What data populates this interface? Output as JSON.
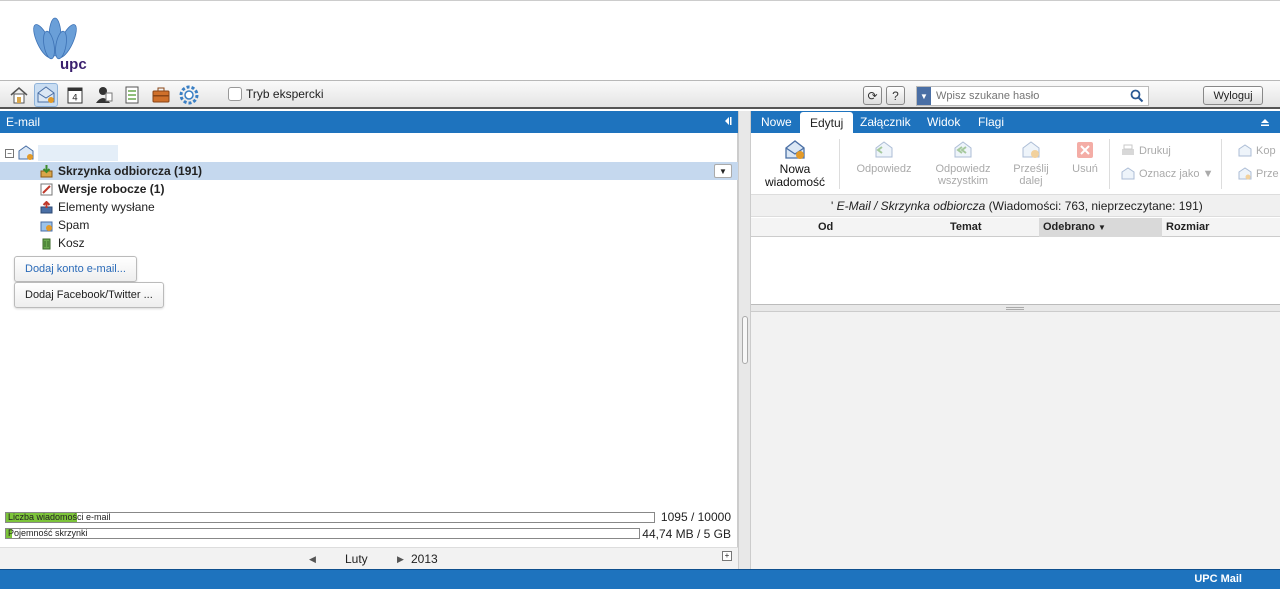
{
  "brand": {
    "logo_text": "upc"
  },
  "toolbar": {
    "icons": [
      "home-icon",
      "email-icon",
      "calendar-icon",
      "contacts-icon",
      "tasks-icon",
      "briefcase-icon",
      "settings-icon"
    ],
    "calendar_day": "4",
    "expert_mode_label": "Tryb ekspercki",
    "search_placeholder": "Wpisz szukane hasło",
    "logout_label": "Wyloguj"
  },
  "left_panel": {
    "title": "E-mail",
    "folders": [
      {
        "name": "Skrzynka odbiorcza (191)",
        "bold": true,
        "selected": true,
        "icon": "inbox-icon"
      },
      {
        "name": "Wersje robocze (1)",
        "bold": true,
        "selected": false,
        "icon": "drafts-icon"
      },
      {
        "name": "Elementy wysłane",
        "bold": false,
        "selected": false,
        "icon": "sent-icon"
      },
      {
        "name": "Spam",
        "bold": false,
        "selected": false,
        "icon": "spam-icon"
      },
      {
        "name": "Kosz",
        "bold": false,
        "selected": false,
        "icon": "trash-icon"
      }
    ],
    "add_email_account": "Dodaj konto e-mail...",
    "add_social": "Dodaj Facebook/Twitter ...",
    "quota_messages": {
      "label": "Liczba wiadomości e-mail",
      "value": "1095 / 10000",
      "fraction": 0.1095
    },
    "quota_storage": {
      "label": "Pojemność skrzynki",
      "value": "44,74 MB / 5 GB",
      "fraction": 0.009
    },
    "calendar_nav": {
      "month": "Luty",
      "year": "2013"
    }
  },
  "right_panel": {
    "tabs": [
      "Nowe",
      "Edytuj",
      "Załącznik",
      "Widok",
      "Flagi"
    ],
    "active_tab": "Edytuj",
    "ribbon": {
      "new_message": "Nowa wiadomość",
      "reply": "Odpowiedz",
      "reply_all": "Odpowiedz wszystkim",
      "forward": "Prześlij dalej",
      "delete": "Usuń",
      "print": "Drukuj",
      "mark_as": "Oznacz jako ▼",
      "copy": "Kop",
      "move": "Prze"
    },
    "breadcrumb_prefix": "' ",
    "breadcrumb_path": "E-Mail / Skrzynka odbiorcza",
    "breadcrumb_stats": " (Wiadomości: 763, nieprzeczytane: 191)",
    "columns": {
      "from": "Od",
      "subject": "Temat",
      "received": "Odebrano",
      "size": "Rozmiar"
    }
  },
  "footer": {
    "label": "UPC Mail"
  },
  "colors": {
    "accent": "#1e73be",
    "quota_fill": "#7cc43a",
    "selected_row": "#c5d8ee"
  }
}
